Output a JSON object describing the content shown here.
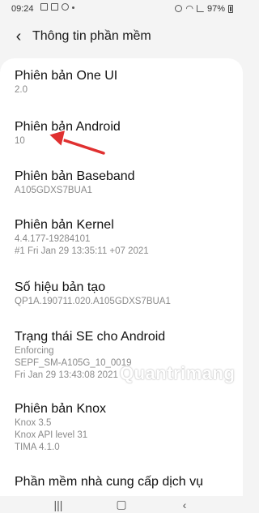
{
  "status": {
    "time": "09:24",
    "battery": "97%"
  },
  "header": {
    "title": "Thông tin phần mềm"
  },
  "items": [
    {
      "title": "Phiên bản One UI",
      "lines": [
        "2.0"
      ]
    },
    {
      "title": "Phiên bản Android",
      "lines": [
        "10"
      ]
    },
    {
      "title": "Phiên bản Baseband",
      "lines": [
        "A105GDXS7BUA1"
      ]
    },
    {
      "title": "Phiên bản Kernel",
      "lines": [
        "4.4.177-19284101",
        "#1 Fri Jan 29 13:35:11 +07 2021"
      ]
    },
    {
      "title": "Số hiệu bản tạo",
      "lines": [
        "QP1A.190711.020.A105GDXS7BUA1"
      ]
    },
    {
      "title": "Trạng thái SE cho Android",
      "lines": [
        "Enforcing",
        "SEPF_SM-A105G_10_0019",
        "Fri Jan 29 13:43:08 2021"
      ]
    },
    {
      "title": "Phiên bản Knox",
      "lines": [
        "Knox 3.5",
        "Knox API level 31",
        "TIMA 4.1.0"
      ]
    },
    {
      "title": "Phần mềm nhà cung cấp dịch vụ",
      "lines": []
    }
  ],
  "watermark": "Quantrimang",
  "colors": {
    "arrow": "#e03030",
    "background": "#f4f4f4",
    "card": "#ffffff",
    "secondary_text": "#8a8a8a"
  }
}
